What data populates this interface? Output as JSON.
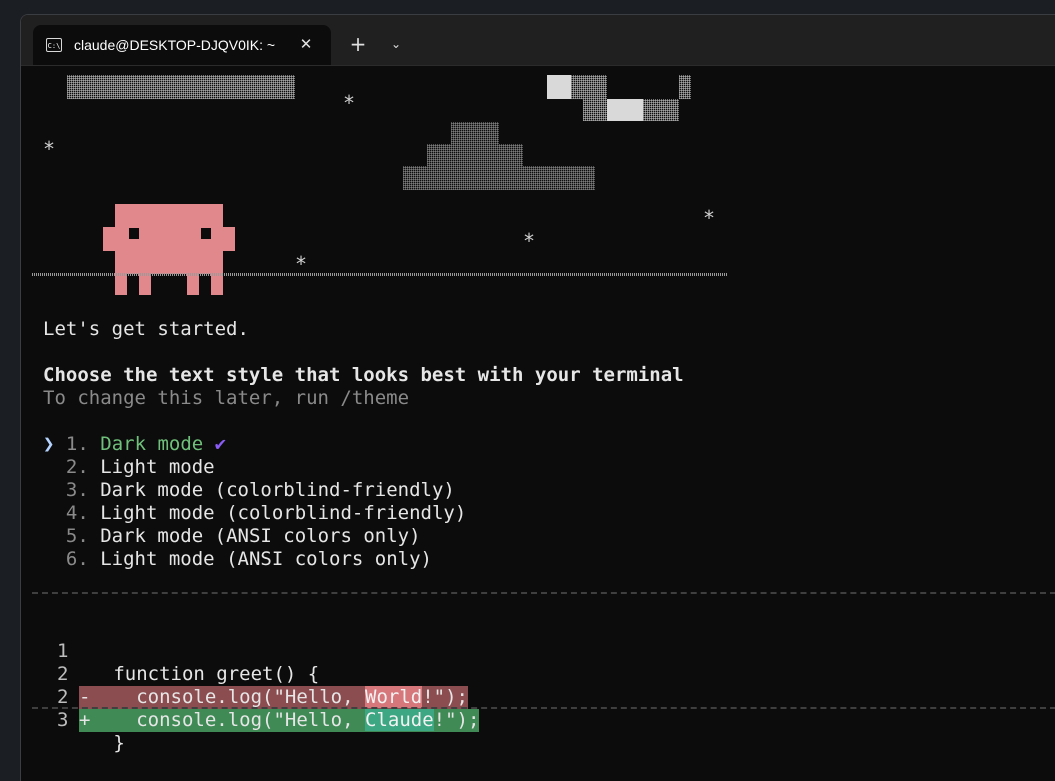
{
  "window": {
    "tab_title": "claude@DESKTOP-DJQV0IK: ~",
    "tab_icon_text": "C:\\",
    "close_glyph": "✕",
    "newtab_glyph": "+",
    "dropdown_glyph": "⌄"
  },
  "splash": {
    "star": "*",
    "mascot_color": "#e0888c"
  },
  "intro": {
    "greeting": "Let's get started.",
    "heading": "Choose the text style that looks best with your terminal",
    "hint": "To change this later, run /theme"
  },
  "theme_options": {
    "cursor": "❯",
    "checkmark": "✔",
    "items": [
      {
        "num": "1.",
        "label": "Dark mode"
      },
      {
        "num": "2.",
        "label": "Light mode"
      },
      {
        "num": "3.",
        "label": "Dark mode (colorblind-friendly)"
      },
      {
        "num": "4.",
        "label": "Light mode (colorblind-friendly)"
      },
      {
        "num": "5.",
        "label": "Dark mode (ANSI colors only)"
      },
      {
        "num": "6.",
        "label": "Light mode (ANSI colors only)"
      }
    ]
  },
  "preview": {
    "lines": [
      {
        "num": "1",
        "marker": " ",
        "code": "  function greet() {"
      },
      {
        "num": "2",
        "marker": "-",
        "pre": "    console.log(\"Hello, ",
        "hl": "World",
        "post": "!\");"
      },
      {
        "num": "2",
        "marker": "+",
        "pre": "    console.log(\"Hello, ",
        "hl": "Claude",
        "post": "!\");"
      },
      {
        "num": "3",
        "marker": " ",
        "code": "  }"
      }
    ]
  },
  "colors": {
    "selected_option": "#6fc07a",
    "checkmark": "#8a5cf6",
    "diff_removed_bg": "#8c4d50",
    "diff_added_bg": "#3f8a55"
  }
}
